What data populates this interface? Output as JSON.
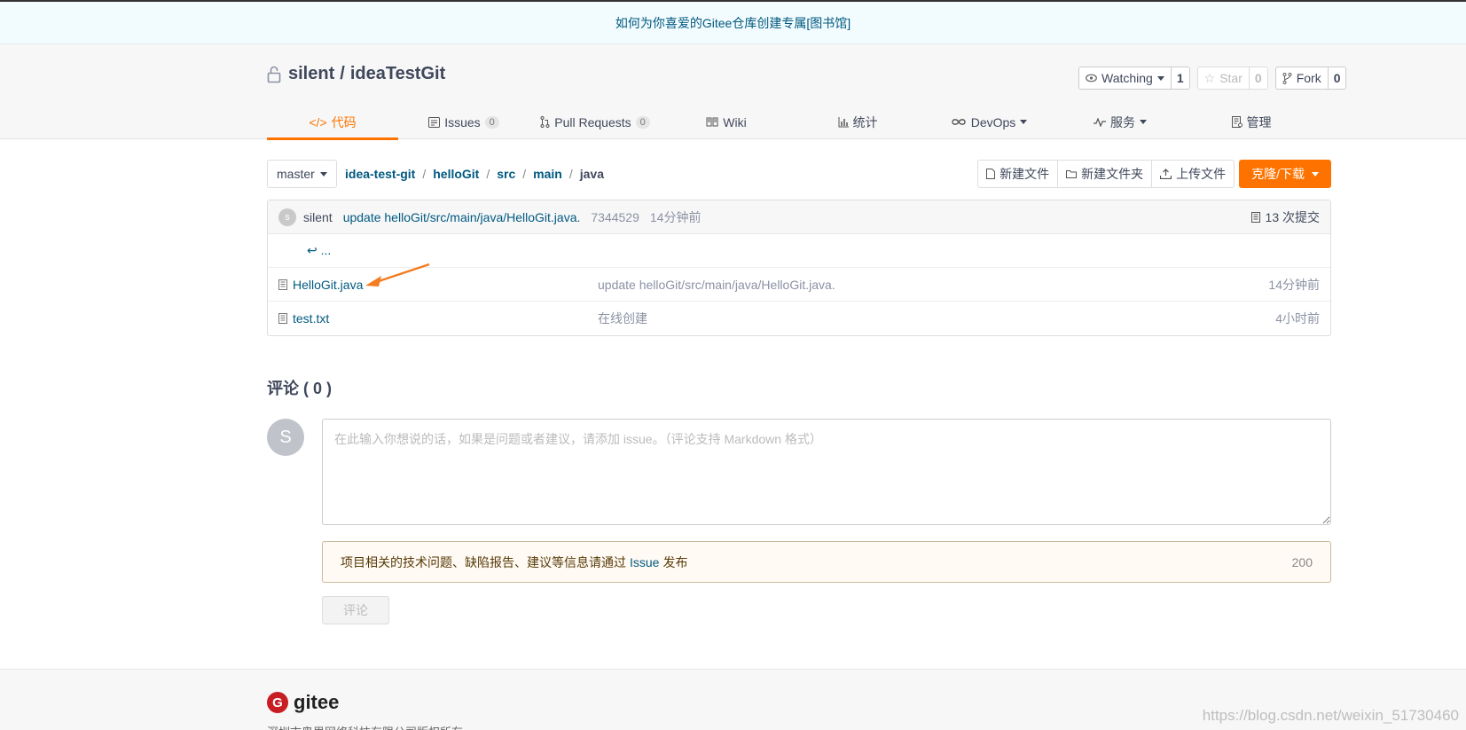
{
  "notice": {
    "text": "如何为你喜爱的Gitee仓库创建专属[图书馆]"
  },
  "repo": {
    "owner": "silent",
    "separator": "/",
    "name": "ideaTestGit"
  },
  "actions": {
    "watching": {
      "label": "Watching",
      "count": "1"
    },
    "star": {
      "label": "Star",
      "count": "0"
    },
    "fork": {
      "label": "Fork",
      "count": "0"
    }
  },
  "tabs": [
    {
      "label": "代码",
      "icon": "code-icon",
      "active": true
    },
    {
      "label": "Issues",
      "badge": "0",
      "icon": "issues-icon"
    },
    {
      "label": "Pull Requests",
      "badge": "0",
      "icon": "pull-request-icon"
    },
    {
      "label": "Wiki",
      "icon": "book-icon"
    },
    {
      "label": "统计",
      "icon": "bar-chart-icon"
    },
    {
      "label": "DevOps",
      "icon": "infinity-icon"
    },
    {
      "label": "服务",
      "icon": "pulse-icon"
    },
    {
      "label": "管理",
      "icon": "settings-doc-icon"
    }
  ],
  "branch": {
    "name": "master"
  },
  "breadcrumb": [
    "idea-test-git",
    "helloGit",
    "src",
    "main",
    "java"
  ],
  "file_buttons": {
    "new_file": "新建文件",
    "new_folder": "新建文件夹",
    "upload": "上传文件",
    "clone": "克隆/下载"
  },
  "last_commit": {
    "avatar_letter": "s",
    "author": "silent",
    "message": "update helloGit/src/main/java/HelloGit.java.",
    "sha": "7344529",
    "time": "14分钟前",
    "total": "13 次提交"
  },
  "tree": {
    "up_label": "...",
    "files": [
      {
        "name": "HelloGit.java",
        "message": "update helloGit/src/main/java/HelloGit.java.",
        "time": "14分钟前"
      },
      {
        "name": "test.txt",
        "message": "在线创建",
        "time": "4小时前"
      }
    ]
  },
  "comments": {
    "title": "评论 ( 0 )",
    "avatar_letter": "S",
    "placeholder": "在此输入你想说的话，如果是问题或者建议，请添加 issue。（评论支持 Markdown 格式）",
    "tip_before": "项目相关的技术问题、缺陷报告、建议等信息请通过",
    "tip_link": "Issue",
    "tip_after": "发布",
    "limit": "200",
    "submit": "评论"
  },
  "footer": {
    "logo_letter": "G",
    "logo_text": "gitee",
    "note": "深圳市奥思网络科技有限公司版权所有"
  },
  "watermark": "https://blog.csdn.net/weixin_51730460",
  "colors": {
    "accent": "#fe7300",
    "link": "#005980",
    "text": "#40485b"
  }
}
